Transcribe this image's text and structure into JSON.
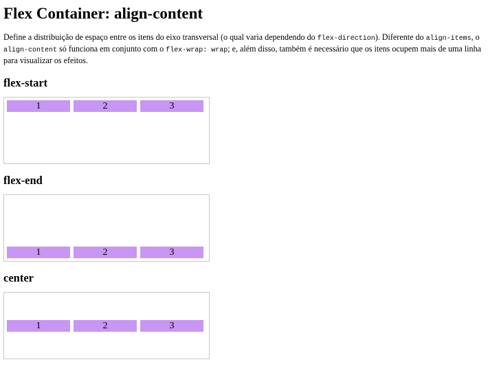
{
  "page": {
    "title": "Flex Container: align-content",
    "description": {
      "part1": "Define a distribuição de espaço entre os itens do eixo transversal (o qual varia dependendo do ",
      "code1": "flex-direction",
      "part2": "). Diferente do ",
      "code2": "align-items",
      "part3": ", o ",
      "code3": "align-content",
      "part4": " só funciona em conjunto com o ",
      "code4": "flex-wrap: wrap",
      "part5": "; e, além disso, também é necessário que os itens ocupem mais de uma linha para visualizar os efeitos."
    }
  },
  "sections": [
    {
      "title": "flex-start",
      "items": [
        "1",
        "2",
        "3"
      ]
    },
    {
      "title": "flex-end",
      "items": [
        "1",
        "2",
        "3"
      ]
    },
    {
      "title": "center",
      "items": [
        "1",
        "2",
        "3"
      ]
    }
  ],
  "colors": {
    "item_background": "#c896f3",
    "box_border": "#c8c8c8"
  }
}
